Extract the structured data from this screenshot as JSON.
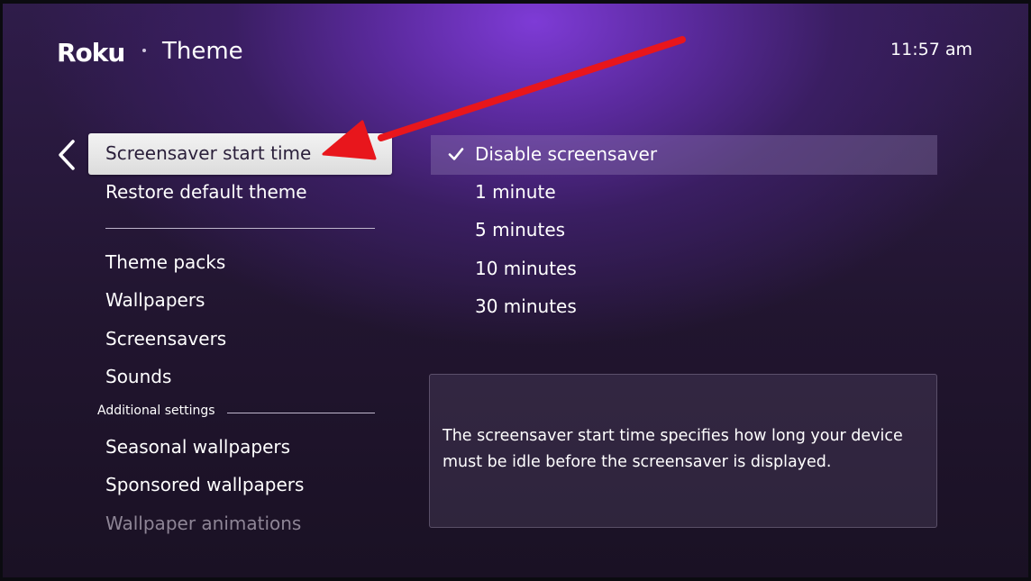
{
  "header": {
    "logo": "Roku",
    "title": "Theme",
    "clock": "11:57 am"
  },
  "icons": {
    "back": "chevron-left-icon",
    "check": "checkmark-icon",
    "annotation": "red-arrow-icon"
  },
  "colors": {
    "background_accent": "#7e3bd6",
    "focus_highlight": "#e8e8e8",
    "annotation_arrow": "#e8161c"
  },
  "menu": {
    "focused": "Screensaver start time",
    "items": [
      "Restore default theme",
      "Theme packs",
      "Wallpapers",
      "Screensavers",
      "Sounds"
    ],
    "section_label": "Additional settings",
    "additional": [
      "Seasonal wallpapers",
      "Sponsored wallpapers",
      "Wallpaper animations"
    ]
  },
  "options": {
    "selected": "Disable screensaver",
    "items": [
      "1 minute",
      "5 minutes",
      "10 minutes",
      "30 minutes"
    ]
  },
  "info": {
    "text": "The screensaver start time specifies how long your device must be idle before the screensaver is displayed."
  }
}
